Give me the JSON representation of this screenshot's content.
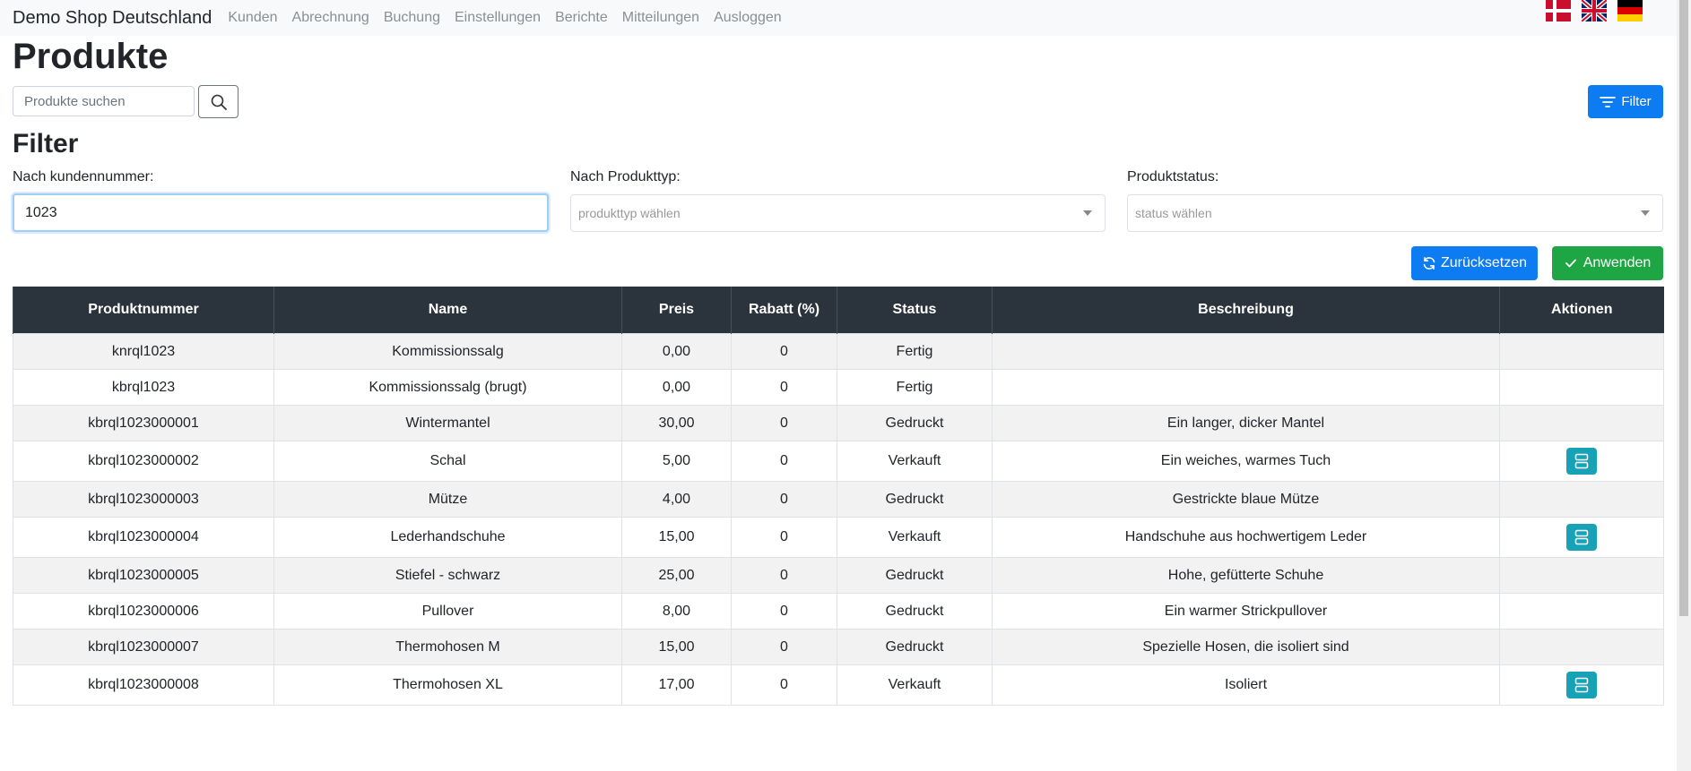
{
  "navbar": {
    "brand": "Demo Shop Deutschland",
    "links": [
      "Kunden",
      "Abrechnung",
      "Buchung",
      "Einstellungen",
      "Berichte",
      "Mitteilungen",
      "Ausloggen"
    ],
    "flags": [
      "denmark-flag-icon",
      "uk-flag-icon",
      "germany-flag-icon"
    ]
  },
  "page": {
    "title": "Produkte",
    "search_placeholder": "Produkte suchen",
    "filter_button": "Filter"
  },
  "filter": {
    "title": "Filter",
    "customer_label": "Nach kundennummer:",
    "customer_value": "1023",
    "type_label": "Nach Produkttyp:",
    "type_placeholder": "produkttyp wählen",
    "status_label": "Produktstatus:",
    "status_placeholder": "status wählen",
    "reset_button": "Zurücksetzen",
    "apply_button": "Anwenden"
  },
  "table": {
    "headers": [
      "Produktnummer",
      "Name",
      "Preis",
      "Rabatt (%)",
      "Status",
      "Beschreibung",
      "Aktionen"
    ],
    "rows": [
      {
        "nummer": "knrql1023",
        "name": "Kommissionssalg",
        "preis": "0,00",
        "rabatt": "0",
        "status": "Fertig",
        "beschreibung": "",
        "aktion": false
      },
      {
        "nummer": "kbrql1023",
        "name": "Kommissionssalg (brugt)",
        "preis": "0,00",
        "rabatt": "0",
        "status": "Fertig",
        "beschreibung": "",
        "aktion": false
      },
      {
        "nummer": "kbrql1023000001",
        "name": "Wintermantel",
        "preis": "30,00",
        "rabatt": "0",
        "status": "Gedruckt",
        "beschreibung": "Ein langer, dicker Mantel",
        "aktion": false
      },
      {
        "nummer": "kbrql1023000002",
        "name": "Schal",
        "preis": "5,00",
        "rabatt": "0",
        "status": "Verkauft",
        "beschreibung": "Ein weiches, warmes Tuch",
        "aktion": true
      },
      {
        "nummer": "kbrql1023000003",
        "name": "Mütze",
        "preis": "4,00",
        "rabatt": "0",
        "status": "Gedruckt",
        "beschreibung": "Gestrickte blaue Mütze",
        "aktion": false
      },
      {
        "nummer": "kbrql1023000004",
        "name": "Lederhandschuhe",
        "preis": "15,00",
        "rabatt": "0",
        "status": "Verkauft",
        "beschreibung": "Handschuhe aus hochwertigem Leder",
        "aktion": true
      },
      {
        "nummer": "kbrql1023000005",
        "name": "Stiefel - schwarz",
        "preis": "25,00",
        "rabatt": "0",
        "status": "Gedruckt",
        "beschreibung": "Hohe, gefütterte Schuhe",
        "aktion": false
      },
      {
        "nummer": "kbrql1023000006",
        "name": "Pullover",
        "preis": "8,00",
        "rabatt": "0",
        "status": "Gedruckt",
        "beschreibung": "Ein warmer Strickpullover",
        "aktion": false
      },
      {
        "nummer": "kbrql1023000007",
        "name": "Thermohosen M",
        "preis": "15,00",
        "rabatt": "0",
        "status": "Gedruckt",
        "beschreibung": "Spezielle Hosen, die isoliert sind",
        "aktion": false
      },
      {
        "nummer": "kbrql1023000008",
        "name": "Thermohosen XL",
        "preis": "17,00",
        "rabatt": "0",
        "status": "Verkauft",
        "beschreibung": "Isoliert",
        "aktion": true
      }
    ]
  },
  "colors": {
    "primary": "#0d7cf2",
    "success": "#1ea544",
    "table_header": "#2b343c",
    "action": "#17a2b8"
  }
}
